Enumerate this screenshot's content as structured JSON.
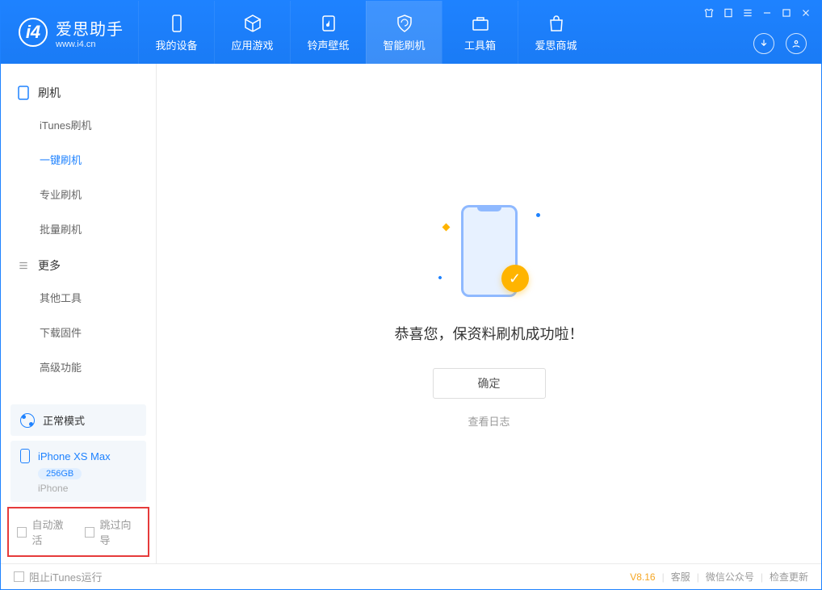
{
  "app": {
    "name": "爱思助手",
    "site": "www.i4.cn"
  },
  "nav": {
    "tabs": [
      {
        "label": "我的设备"
      },
      {
        "label": "应用游戏"
      },
      {
        "label": "铃声壁纸"
      },
      {
        "label": "智能刷机"
      },
      {
        "label": "工具箱"
      },
      {
        "label": "爱思商城"
      }
    ]
  },
  "sidebar": {
    "sections": [
      {
        "title": "刷机",
        "items": [
          "iTunes刷机",
          "一键刷机",
          "专业刷机",
          "批量刷机"
        ],
        "active_index": 1
      },
      {
        "title": "更多",
        "items": [
          "其他工具",
          "下载固件",
          "高级功能"
        ]
      }
    ],
    "mode": "正常模式",
    "device": {
      "name": "iPhone XS Max",
      "storage": "256GB",
      "type": "iPhone"
    },
    "options": {
      "auto_activate": "自动激活",
      "skip_wizard": "跳过向导"
    }
  },
  "main": {
    "success_msg": "恭喜您，保资料刷机成功啦！",
    "ok_button": "确定",
    "view_log": "查看日志"
  },
  "statusbar": {
    "block_itunes": "阻止iTunes运行",
    "version": "V8.16",
    "links": [
      "客服",
      "微信公众号",
      "检查更新"
    ]
  }
}
